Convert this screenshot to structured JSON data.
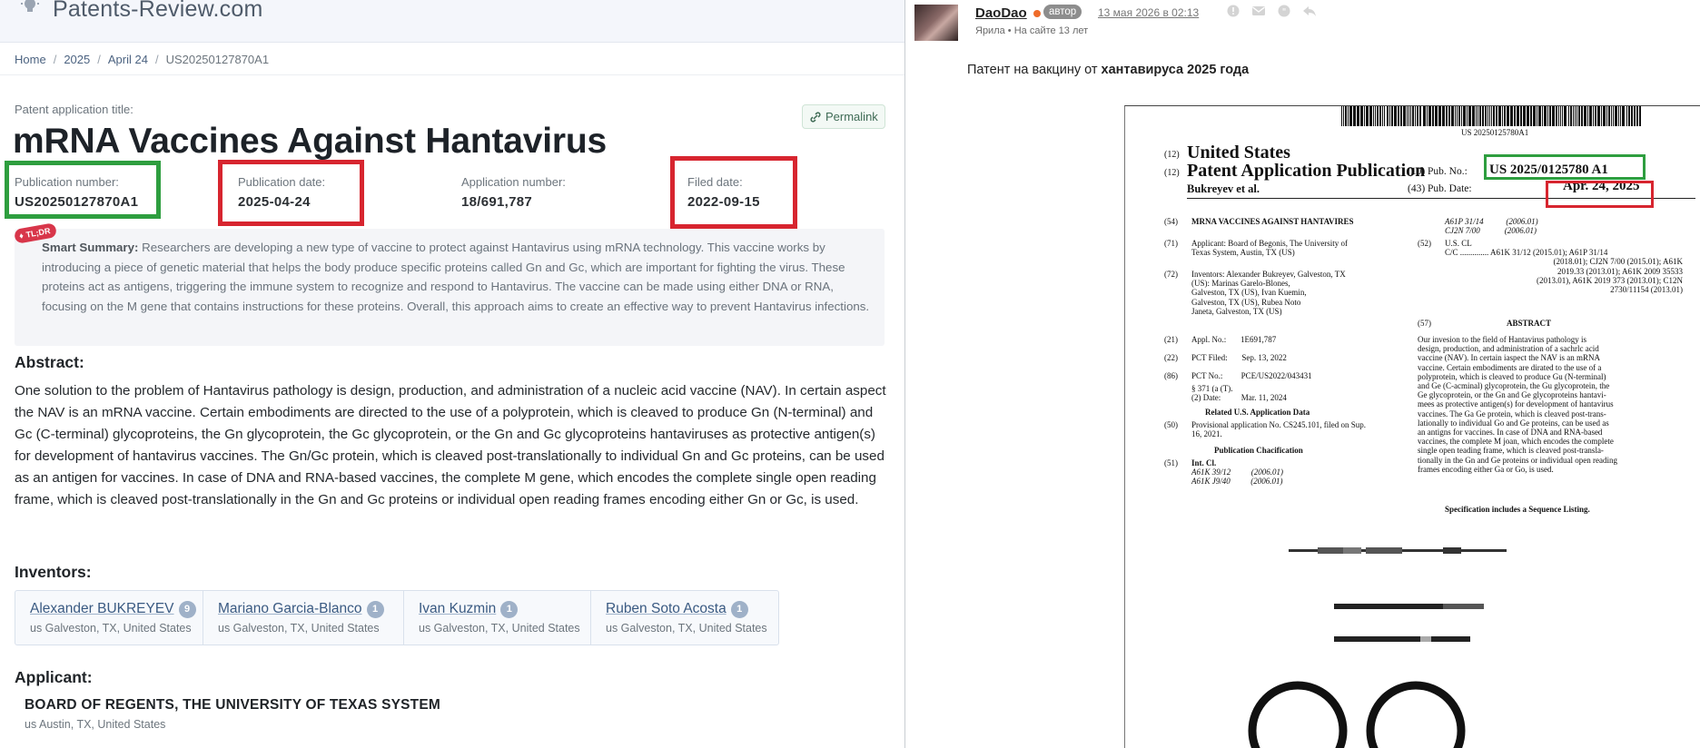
{
  "left": {
    "site_name": "Patents-Review.com",
    "breadcrumb": [
      "Home",
      "2025",
      "April 24",
      "US20250127870A1"
    ],
    "title_label": "Patent application title:",
    "title": "mRNA Vaccines Against Hantavirus",
    "permalink": "Permalink",
    "meta": {
      "publication_number_label": "Publication number:",
      "publication_number": "US20250127870A1",
      "publication_date_label": "Publication date:",
      "publication_date": "2025-04-24",
      "application_number_label": "Application number:",
      "application_number": "18/691,787",
      "filed_date_label": "Filed date:",
      "filed_date": "2022-09-15"
    },
    "tldr_badge": "TL;DR",
    "summary_label": "Smart Summary:",
    "summary": "Researchers are developing a new type of vaccine to protect against Hantavirus using mRNA technology. This vaccine works by introducing a piece of genetic material that helps the body produce specific proteins called Gn and Gc, which are important for fighting the virus. These proteins act as antigens, triggering the immune system to recognize and respond to Hantavirus. The vaccine can be made using either DNA or RNA, focusing on the M gene that contains instructions for these proteins. Overall, this approach aims to create an effective way to prevent Hantavirus infections.",
    "abstract_heading": "Abstract:",
    "abstract": "One solution to the problem of Hantavirus pathology is design, production, and administration of a nucleic acid vaccine (NAV). In certain aspect the NAV is an mRNA vaccine. Certain embodiments are directed to the use of a polyprotein, which is cleaved to produce Gn (N-terminal) and Gc (C-terminal) glycoproteins, the Gn glycoprotein, the Gc glycoprotein, or the Gn and Gc glycoproteins hantaviruses as protective antigen(s) for development of hantavirus vaccines. The Gn/Gc protein, which is cleaved post-translationally to individual Gn and Gc proteins, can be used as an antigen for vaccines. In case of DNA and RNA-based vaccines, the complete M gene, which encodes the complete single open reading frame, which is cleaved post-translationally in the Gn and Gc proteins or individual open reading frames encoding either Gn or Gc, is used.",
    "inventors_heading": "Inventors:",
    "inventors": [
      {
        "name": "Alexander BUKREYEV",
        "count": "9",
        "location": "us Galveston, TX, United States"
      },
      {
        "name": "Mariano Garcia-Blanco",
        "count": "1",
        "location": "us Galveston, TX, United States"
      },
      {
        "name": "Ivan Kuzmin",
        "count": "1",
        "location": "us Galveston, TX, United States"
      },
      {
        "name": "Ruben Soto Acosta",
        "count": "1",
        "location": "us Galveston, TX, United States"
      }
    ],
    "applicant_heading": "Applicant:",
    "applicant_name": "BOARD OF REGENTS, THE UNIVERSITY OF TEXAS SYSTEM",
    "applicant_location": "us Austin, TX, United States"
  },
  "right": {
    "username": "DaoDao",
    "author_badge": "автор",
    "post_date": "13 мая 2026 в 02:13",
    "user_meta": "Ярила  •  На сайте 13 лет",
    "post_text_prefix": "Патент на вакцину от",
    "post_text_bold": "хантавируса 2025 года",
    "document": {
      "barcode_number": "US 20250125780A1",
      "h12a_num": "(12)",
      "h12a": "United States",
      "h12b_num": "(12)",
      "h12b": "Patent Application Publication",
      "pub_no_label": "(10) Pub. No.:",
      "pub_no": "US 2025/0125780 A1",
      "pub_date_label": "(43) Pub. Date:",
      "pub_date": "Apr. 24, 2025",
      "authors": "Bukreyev et al.",
      "f54_num": "(54)",
      "f54": "MRNA VACCINES AGAINST HANTAVIRES",
      "f71_num": "(71)",
      "f71": [
        "Applicant: Board of Begonis, The University of",
        "Texas System, Austin, TX (US)"
      ],
      "f72_num": "(72)",
      "f72": [
        "Inventors: Alexander Bukreyev, Galveston, TX",
        "(US): Marinas Garelo-Blones,",
        "Galveston, TX (US), Ivan Kuemin,",
        "Galveston, TX (US), Rubea Noto",
        "Janeta, Galveston, TX (US)"
      ],
      "f21_num": "(21)",
      "f21": "Appl. No.:       1E691,787",
      "f22_num": "(22)",
      "f22": "PCT Filed:       Sep. 13, 2022",
      "f86_num": "(86)",
      "f86": [
        "PCT No.:         PCE/US2022/043431",
        "§ 371 (a (T).",
        "(2) Date:          Mar. 11, 2024"
      ],
      "related_heading": "Related U.S. Application Data",
      "f60_num": "(50)",
      "f60": [
        "Provisional application No. CS245.101, filed on Sup.",
        "16, 2021."
      ],
      "pubclass_heading": "Publication Chacification",
      "f51_num": "(51)",
      "f51": [
        "Int. Cl.",
        "A61K 39/12          (2006.01)",
        "A61K J9/40          (2006.01)"
      ],
      "right_col_top": [
        "A61P 31/14           (2006.01)",
        "CJ2N 7/00            (2006.01)"
      ],
      "f52_num": "(52)",
      "f52": [
        "U.S. CL",
        "C/C .............. A61K 31/12 (2015.01); A61P 31/14",
        "(2018.01); CJ2N 7/00 (2015.01); A61K",
        "2019.33 (2013.01); A61K 2009 35533",
        "(2013.01), A61K 2019 373 (2013.01); C12N",
        "2730/11154 (2013.01)"
      ],
      "f57_num": "(57)",
      "abstract_heading": "ABSTRACT",
      "abstract": [
        "Our invesion to the field of Hantavirus pathology is",
        "design, production, and administration of a sachrlc acid",
        "vaccine (NAV). In certain iaspect the NAV is an mRNA",
        "vaccine. Certain embodiments are dirated to the use of a",
        "polyprotein, which is cleaved to produce Gu (N-terminal)",
        "and Ge (C-acminal) glycoprotein, the Gu glycoprotein, the",
        "Ge glycoprotein, or the Gn and Ge glycoproteins hantavi-",
        "mees as protective antigen(s) for development of hantavirus",
        "vaccines. The Ga Ge protein, which is cleaved post-trans-",
        "lationally to individual Go and Ge proteins, can be used as",
        "an antigns for vaccines. In case of DNA and RNA-based",
        "vaccines, the complete M joan, which encodes the complete",
        "single open teading frame, which is cleaved post-transla-",
        "tionally in the Gn and Ge proteins or individual open reading",
        "frames encoding either Ga or Go, is used."
      ],
      "seq_listing": "Specification includes a Sequence Listing."
    }
  }
}
